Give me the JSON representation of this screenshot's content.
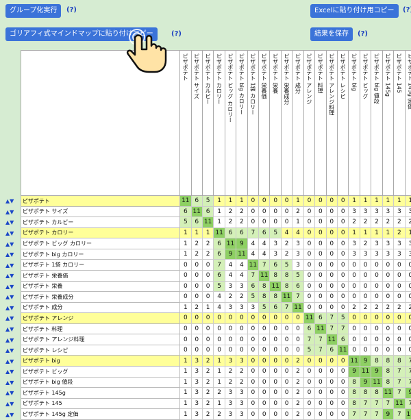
{
  "toolbar": {
    "group_button": "グループ化実行",
    "excel_button": "Excelに貼り付け用コピー",
    "mindmap_button": "ゴリアフィ式マインドマップに貼り付けコピー",
    "save_button": "結果を保存",
    "help": "(?)"
  },
  "columns": [
    "ピザポテト",
    "ピザポテト サイズ",
    "ピザポテト カルビー",
    "ピザポテト カロリー",
    "ピザポテト ビッグ カロリー",
    "ピザポテト big カロリー",
    "ピザポテト 1袋 カロリー",
    "ピザポテト 栄養価",
    "ピザポテト 栄養",
    "ピザポテト 栄養成分",
    "ピザポテト 成分",
    "ピザポテト アレンジ",
    "ピザポテト 料理",
    "ピザポテト アレンジ料理",
    "ピザポテト レシピ",
    "ピザポテト big",
    "ピザポテト ビッグ",
    "ピザポテト big 値段",
    "ピザポテト 145g",
    "ピザポテト 145",
    "ピザポテト 145g 定価"
  ],
  "rows": [
    {
      "label": "ピザポテト",
      "hl": true,
      "values": [
        11,
        6,
        5,
        1,
        1,
        1,
        0,
        0,
        0,
        0,
        1,
        0,
        0,
        0,
        0,
        1,
        1,
        1,
        1,
        1,
        1
      ]
    },
    {
      "label": "ピザポテト サイズ",
      "hl": false,
      "values": [
        6,
        11,
        6,
        1,
        2,
        2,
        0,
        0,
        0,
        0,
        2,
        0,
        0,
        0,
        0,
        3,
        3,
        3,
        3,
        3,
        3
      ]
    },
    {
      "label": "ピザポテト カルビー",
      "hl": false,
      "values": [
        5,
        6,
        11,
        1,
        2,
        2,
        0,
        0,
        0,
        0,
        1,
        0,
        0,
        0,
        0,
        2,
        2,
        2,
        2,
        2,
        2
      ]
    },
    {
      "label": "ピザポテト カロリー",
      "hl": true,
      "values": [
        1,
        1,
        1,
        11,
        6,
        6,
        7,
        6,
        5,
        4,
        4,
        0,
        0,
        0,
        0,
        1,
        1,
        1,
        1,
        2,
        1
      ]
    },
    {
      "label": "ピザポテト ビッグ カロリー",
      "hl": false,
      "values": [
        1,
        2,
        2,
        6,
        11,
        9,
        4,
        4,
        3,
        2,
        3,
        0,
        0,
        0,
        0,
        3,
        2,
        3,
        3,
        3,
        3
      ]
    },
    {
      "label": "ピザポテト big カロリー",
      "hl": false,
      "values": [
        1,
        2,
        2,
        6,
        9,
        11,
        4,
        4,
        3,
        2,
        3,
        0,
        0,
        0,
        0,
        3,
        3,
        3,
        3,
        3,
        3
      ]
    },
    {
      "label": "ピザポテト 1袋 カロリー",
      "hl": false,
      "values": [
        0,
        0,
        0,
        7,
        4,
        4,
        11,
        7,
        6,
        5,
        3,
        0,
        0,
        0,
        0,
        0,
        0,
        0,
        0,
        0,
        0
      ]
    },
    {
      "label": "ピザポテト 栄養価",
      "hl": false,
      "values": [
        0,
        0,
        0,
        6,
        4,
        4,
        7,
        11,
        8,
        8,
        5,
        0,
        0,
        0,
        0,
        0,
        0,
        0,
        0,
        0,
        0
      ]
    },
    {
      "label": "ピザポテト 栄養",
      "hl": false,
      "values": [
        0,
        0,
        0,
        5,
        3,
        3,
        6,
        8,
        11,
        8,
        6,
        0,
        0,
        0,
        0,
        0,
        0,
        0,
        0,
        0,
        0
      ]
    },
    {
      "label": "ピザポテト 栄養成分",
      "hl": false,
      "values": [
        0,
        0,
        0,
        4,
        2,
        2,
        5,
        8,
        8,
        11,
        7,
        0,
        0,
        0,
        0,
        0,
        0,
        0,
        0,
        0,
        0
      ]
    },
    {
      "label": "ピザポテト 成分",
      "hl": false,
      "values": [
        1,
        2,
        1,
        4,
        3,
        3,
        3,
        5,
        6,
        7,
        11,
        0,
        0,
        0,
        0,
        2,
        2,
        2,
        2,
        2,
        2
      ]
    },
    {
      "label": "ピザポテト アレンジ",
      "hl": true,
      "values": [
        0,
        0,
        0,
        0,
        0,
        0,
        0,
        0,
        0,
        0,
        0,
        11,
        6,
        7,
        5,
        0,
        0,
        0,
        0,
        0,
        0
      ]
    },
    {
      "label": "ピザポテト 料理",
      "hl": false,
      "values": [
        0,
        0,
        0,
        0,
        0,
        0,
        0,
        0,
        0,
        0,
        0,
        6,
        11,
        7,
        7,
        0,
        0,
        0,
        0,
        0,
        0
      ]
    },
    {
      "label": "ピザポテト アレンジ料理",
      "hl": false,
      "values": [
        0,
        0,
        0,
        0,
        0,
        0,
        0,
        0,
        0,
        0,
        0,
        7,
        7,
        11,
        6,
        0,
        0,
        0,
        0,
        0,
        0
      ]
    },
    {
      "label": "ピザポテト レシピ",
      "hl": false,
      "values": [
        0,
        0,
        0,
        0,
        0,
        0,
        0,
        0,
        0,
        0,
        0,
        5,
        7,
        6,
        11,
        0,
        0,
        0,
        0,
        0,
        0
      ]
    },
    {
      "label": "ピザポテト big",
      "hl": true,
      "values": [
        1,
        3,
        2,
        1,
        3,
        3,
        0,
        0,
        0,
        0,
        2,
        0,
        0,
        0,
        0,
        11,
        9,
        8,
        8,
        8,
        7
      ]
    },
    {
      "label": "ピザポテト ビッグ",
      "hl": false,
      "values": [
        1,
        3,
        2,
        1,
        2,
        2,
        0,
        0,
        0,
        0,
        2,
        0,
        0,
        0,
        0,
        9,
        11,
        9,
        8,
        7,
        7
      ]
    },
    {
      "label": "ピザポテト big 値段",
      "hl": false,
      "values": [
        1,
        3,
        2,
        1,
        2,
        2,
        0,
        0,
        0,
        0,
        2,
        0,
        0,
        0,
        0,
        8,
        9,
        11,
        8,
        7,
        7
      ]
    },
    {
      "label": "ピザポテト 145g",
      "hl": false,
      "values": [
        1,
        3,
        2,
        2,
        3,
        3,
        0,
        0,
        0,
        0,
        2,
        0,
        0,
        0,
        0,
        8,
        8,
        8,
        11,
        7,
        9
      ]
    },
    {
      "label": "ピザポテト 145",
      "hl": false,
      "values": [
        1,
        3,
        2,
        1,
        3,
        3,
        0,
        0,
        0,
        0,
        2,
        0,
        0,
        0,
        0,
        8,
        7,
        7,
        7,
        11,
        7
      ]
    },
    {
      "label": "ピザポテト 145g 定価",
      "hl": false,
      "values": [
        1,
        3,
        2,
        2,
        3,
        3,
        0,
        0,
        0,
        0,
        2,
        0,
        0,
        0,
        0,
        7,
        7,
        7,
        9,
        7,
        11
      ]
    }
  ],
  "row_control": "▲▼",
  "colors": {
    "button": "#3b73d9",
    "bg": "#d6ecd2",
    "highlight": "#ffff99",
    "green": "#8ed063",
    "lightgreen": "#d4f0b8"
  },
  "icons": [
    "pointer-hand-icon"
  ]
}
